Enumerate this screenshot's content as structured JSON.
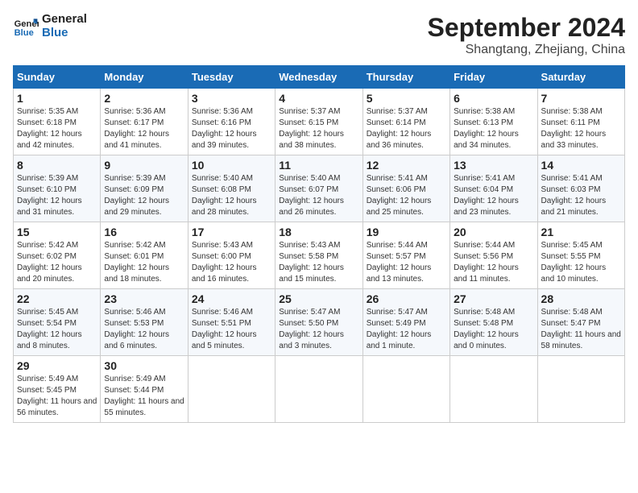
{
  "logo": {
    "line1": "General",
    "line2": "Blue"
  },
  "title": "September 2024",
  "subtitle": "Shangtang, Zhejiang, China",
  "weekdays": [
    "Sunday",
    "Monday",
    "Tuesday",
    "Wednesday",
    "Thursday",
    "Friday",
    "Saturday"
  ],
  "weeks": [
    [
      {
        "day": "1",
        "sunrise": "Sunrise: 5:35 AM",
        "sunset": "Sunset: 6:18 PM",
        "daylight": "Daylight: 12 hours and 42 minutes."
      },
      {
        "day": "2",
        "sunrise": "Sunrise: 5:36 AM",
        "sunset": "Sunset: 6:17 PM",
        "daylight": "Daylight: 12 hours and 41 minutes."
      },
      {
        "day": "3",
        "sunrise": "Sunrise: 5:36 AM",
        "sunset": "Sunset: 6:16 PM",
        "daylight": "Daylight: 12 hours and 39 minutes."
      },
      {
        "day": "4",
        "sunrise": "Sunrise: 5:37 AM",
        "sunset": "Sunset: 6:15 PM",
        "daylight": "Daylight: 12 hours and 38 minutes."
      },
      {
        "day": "5",
        "sunrise": "Sunrise: 5:37 AM",
        "sunset": "Sunset: 6:14 PM",
        "daylight": "Daylight: 12 hours and 36 minutes."
      },
      {
        "day": "6",
        "sunrise": "Sunrise: 5:38 AM",
        "sunset": "Sunset: 6:13 PM",
        "daylight": "Daylight: 12 hours and 34 minutes."
      },
      {
        "day": "7",
        "sunrise": "Sunrise: 5:38 AM",
        "sunset": "Sunset: 6:11 PM",
        "daylight": "Daylight: 12 hours and 33 minutes."
      }
    ],
    [
      {
        "day": "8",
        "sunrise": "Sunrise: 5:39 AM",
        "sunset": "Sunset: 6:10 PM",
        "daylight": "Daylight: 12 hours and 31 minutes."
      },
      {
        "day": "9",
        "sunrise": "Sunrise: 5:39 AM",
        "sunset": "Sunset: 6:09 PM",
        "daylight": "Daylight: 12 hours and 29 minutes."
      },
      {
        "day": "10",
        "sunrise": "Sunrise: 5:40 AM",
        "sunset": "Sunset: 6:08 PM",
        "daylight": "Daylight: 12 hours and 28 minutes."
      },
      {
        "day": "11",
        "sunrise": "Sunrise: 5:40 AM",
        "sunset": "Sunset: 6:07 PM",
        "daylight": "Daylight: 12 hours and 26 minutes."
      },
      {
        "day": "12",
        "sunrise": "Sunrise: 5:41 AM",
        "sunset": "Sunset: 6:06 PM",
        "daylight": "Daylight: 12 hours and 25 minutes."
      },
      {
        "day": "13",
        "sunrise": "Sunrise: 5:41 AM",
        "sunset": "Sunset: 6:04 PM",
        "daylight": "Daylight: 12 hours and 23 minutes."
      },
      {
        "day": "14",
        "sunrise": "Sunrise: 5:41 AM",
        "sunset": "Sunset: 6:03 PM",
        "daylight": "Daylight: 12 hours and 21 minutes."
      }
    ],
    [
      {
        "day": "15",
        "sunrise": "Sunrise: 5:42 AM",
        "sunset": "Sunset: 6:02 PM",
        "daylight": "Daylight: 12 hours and 20 minutes."
      },
      {
        "day": "16",
        "sunrise": "Sunrise: 5:42 AM",
        "sunset": "Sunset: 6:01 PM",
        "daylight": "Daylight: 12 hours and 18 minutes."
      },
      {
        "day": "17",
        "sunrise": "Sunrise: 5:43 AM",
        "sunset": "Sunset: 6:00 PM",
        "daylight": "Daylight: 12 hours and 16 minutes."
      },
      {
        "day": "18",
        "sunrise": "Sunrise: 5:43 AM",
        "sunset": "Sunset: 5:58 PM",
        "daylight": "Daylight: 12 hours and 15 minutes."
      },
      {
        "day": "19",
        "sunrise": "Sunrise: 5:44 AM",
        "sunset": "Sunset: 5:57 PM",
        "daylight": "Daylight: 12 hours and 13 minutes."
      },
      {
        "day": "20",
        "sunrise": "Sunrise: 5:44 AM",
        "sunset": "Sunset: 5:56 PM",
        "daylight": "Daylight: 12 hours and 11 minutes."
      },
      {
        "day": "21",
        "sunrise": "Sunrise: 5:45 AM",
        "sunset": "Sunset: 5:55 PM",
        "daylight": "Daylight: 12 hours and 10 minutes."
      }
    ],
    [
      {
        "day": "22",
        "sunrise": "Sunrise: 5:45 AM",
        "sunset": "Sunset: 5:54 PM",
        "daylight": "Daylight: 12 hours and 8 minutes."
      },
      {
        "day": "23",
        "sunrise": "Sunrise: 5:46 AM",
        "sunset": "Sunset: 5:53 PM",
        "daylight": "Daylight: 12 hours and 6 minutes."
      },
      {
        "day": "24",
        "sunrise": "Sunrise: 5:46 AM",
        "sunset": "Sunset: 5:51 PM",
        "daylight": "Daylight: 12 hours and 5 minutes."
      },
      {
        "day": "25",
        "sunrise": "Sunrise: 5:47 AM",
        "sunset": "Sunset: 5:50 PM",
        "daylight": "Daylight: 12 hours and 3 minutes."
      },
      {
        "day": "26",
        "sunrise": "Sunrise: 5:47 AM",
        "sunset": "Sunset: 5:49 PM",
        "daylight": "Daylight: 12 hours and 1 minute."
      },
      {
        "day": "27",
        "sunrise": "Sunrise: 5:48 AM",
        "sunset": "Sunset: 5:48 PM",
        "daylight": "Daylight: 12 hours and 0 minutes."
      },
      {
        "day": "28",
        "sunrise": "Sunrise: 5:48 AM",
        "sunset": "Sunset: 5:47 PM",
        "daylight": "Daylight: 11 hours and 58 minutes."
      }
    ],
    [
      {
        "day": "29",
        "sunrise": "Sunrise: 5:49 AM",
        "sunset": "Sunset: 5:45 PM",
        "daylight": "Daylight: 11 hours and 56 minutes."
      },
      {
        "day": "30",
        "sunrise": "Sunrise: 5:49 AM",
        "sunset": "Sunset: 5:44 PM",
        "daylight": "Daylight: 11 hours and 55 minutes."
      },
      null,
      null,
      null,
      null,
      null
    ]
  ]
}
